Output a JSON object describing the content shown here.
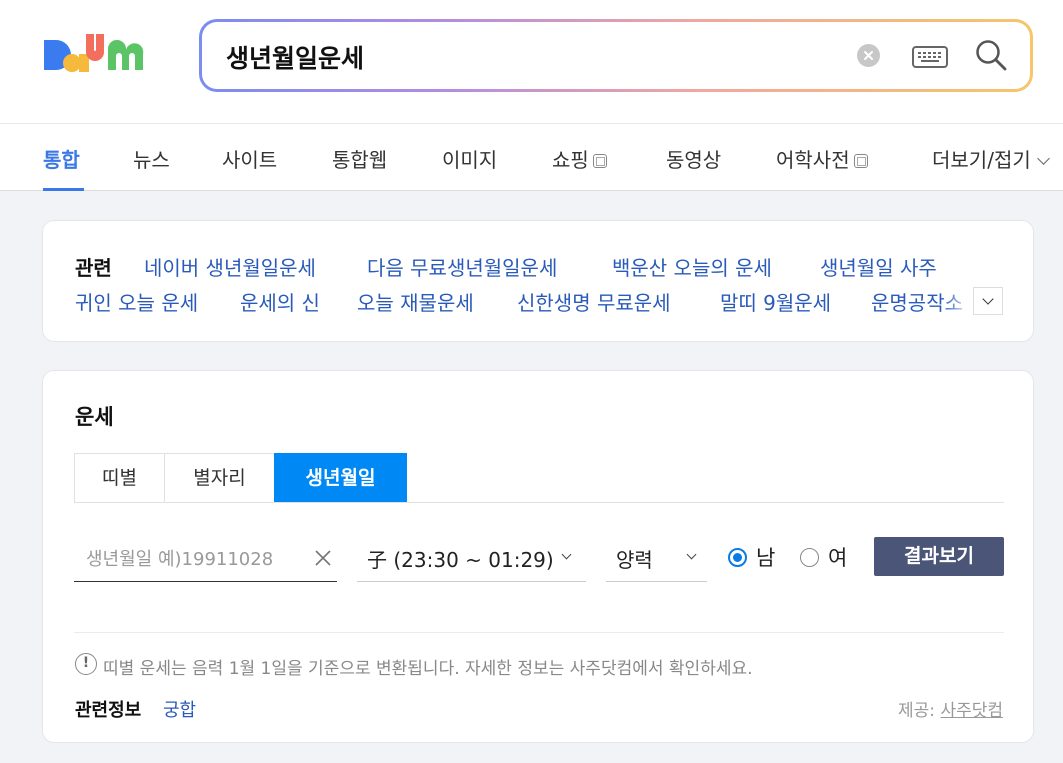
{
  "header": {
    "logo_text": "Daum",
    "search": {
      "query": "생년월일운세"
    }
  },
  "tabs": [
    {
      "label": "통합",
      "active": true
    },
    {
      "label": "뉴스"
    },
    {
      "label": "사이트"
    },
    {
      "label": "통합웹"
    },
    {
      "label": "이미지"
    },
    {
      "label": "쇼핑"
    },
    {
      "label": "동영상"
    },
    {
      "label": "어학사전"
    },
    {
      "label": "더보기/접기"
    }
  ],
  "related": {
    "label": "관련",
    "links": [
      "네이버 생년월일운세",
      "다음 무료생년월일운세",
      "백운산 오늘의 운세",
      "생년월일 사주",
      "귀인 오늘 운세",
      "운세의 신",
      "오늘 재물운세",
      "신한생명 무료운세",
      "말띠 9월운세",
      "운명공작소"
    ]
  },
  "fortune": {
    "title": "운세",
    "tabs": [
      "띠별",
      "별자리",
      "생년월일"
    ],
    "active_tab": "생년월일",
    "birth_placeholder": "생년월일 예)19911028",
    "time_select": "子 (23:30 ~ 01:29)",
    "calendar_select": "양력",
    "gender": {
      "male": "남",
      "female": "여",
      "selected": "남"
    },
    "submit": "결과보기",
    "notice": "띠별 운세는 음력 1월 1일을 기준으로 변환됩니다. 자세한 정보는 사주닷컴에서 확인하세요.",
    "related_info_label": "관련정보",
    "related_info_link": "궁합",
    "provider_label": "제공:",
    "provider_name": "사주닷컴"
  },
  "colors": {
    "accent": "#3b78e7",
    "link": "#2a5bb9",
    "tab_active_bg": "#0089f5",
    "button_bg": "#4a5578",
    "radio_on": "#0a7be6"
  }
}
